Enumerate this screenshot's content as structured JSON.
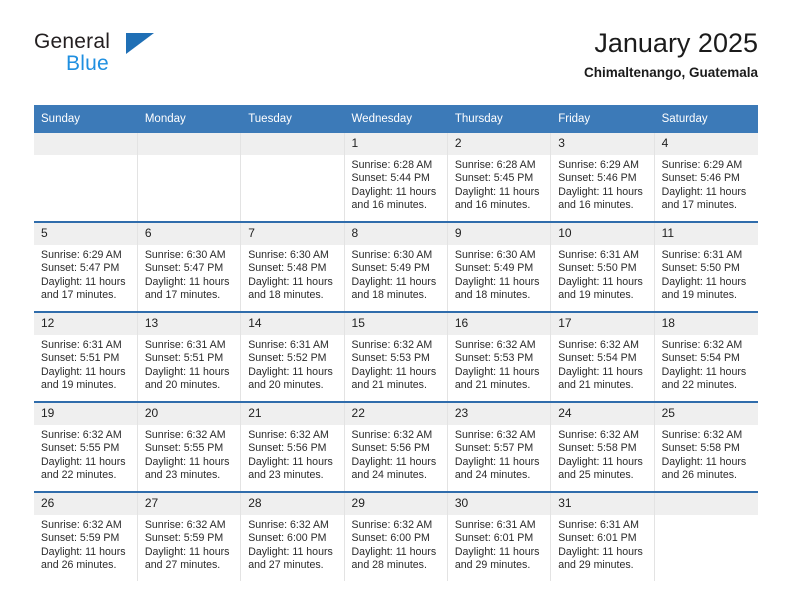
{
  "brand": {
    "name_top": "General",
    "name_bottom": "Blue",
    "triangle_icon": "blue-triangle-logo-icon",
    "color_dark": "#231f20",
    "color_blue": "#1f8fe0",
    "color_triangle": "#1f6fb5"
  },
  "header": {
    "title": "January 2025",
    "subtitle": "Chimaltenango, Guatemala"
  },
  "theme": {
    "header_blue": "#3c7ab8",
    "row_divider_blue": "#2f6cab",
    "daynum_band": "#efefef",
    "text": "#222222"
  },
  "weekday_headers": [
    "Sunday",
    "Monday",
    "Tuesday",
    "Wednesday",
    "Thursday",
    "Friday",
    "Saturday"
  ],
  "labels": {
    "sunrise_prefix": "Sunrise:",
    "sunset_prefix": "Sunset:",
    "daylight_prefix": "Daylight:"
  },
  "weeks": [
    [
      {
        "day": "",
        "sunrise": "",
        "sunset": "",
        "daylight_line1": "",
        "daylight_line2": "",
        "blank": true
      },
      {
        "day": "",
        "sunrise": "",
        "sunset": "",
        "daylight_line1": "",
        "daylight_line2": "",
        "blank": true
      },
      {
        "day": "",
        "sunrise": "",
        "sunset": "",
        "daylight_line1": "",
        "daylight_line2": "",
        "blank": true
      },
      {
        "day": "1",
        "sunrise": "Sunrise: 6:28 AM",
        "sunset": "Sunset: 5:44 PM",
        "daylight_line1": "Daylight: 11 hours",
        "daylight_line2": "and 16 minutes.",
        "blank": false
      },
      {
        "day": "2",
        "sunrise": "Sunrise: 6:28 AM",
        "sunset": "Sunset: 5:45 PM",
        "daylight_line1": "Daylight: 11 hours",
        "daylight_line2": "and 16 minutes.",
        "blank": false
      },
      {
        "day": "3",
        "sunrise": "Sunrise: 6:29 AM",
        "sunset": "Sunset: 5:46 PM",
        "daylight_line1": "Daylight: 11 hours",
        "daylight_line2": "and 16 minutes.",
        "blank": false
      },
      {
        "day": "4",
        "sunrise": "Sunrise: 6:29 AM",
        "sunset": "Sunset: 5:46 PM",
        "daylight_line1": "Daylight: 11 hours",
        "daylight_line2": "and 17 minutes.",
        "blank": false
      }
    ],
    [
      {
        "day": "5",
        "sunrise": "Sunrise: 6:29 AM",
        "sunset": "Sunset: 5:47 PM",
        "daylight_line1": "Daylight: 11 hours",
        "daylight_line2": "and 17 minutes.",
        "blank": false
      },
      {
        "day": "6",
        "sunrise": "Sunrise: 6:30 AM",
        "sunset": "Sunset: 5:47 PM",
        "daylight_line1": "Daylight: 11 hours",
        "daylight_line2": "and 17 minutes.",
        "blank": false
      },
      {
        "day": "7",
        "sunrise": "Sunrise: 6:30 AM",
        "sunset": "Sunset: 5:48 PM",
        "daylight_line1": "Daylight: 11 hours",
        "daylight_line2": "and 18 minutes.",
        "blank": false
      },
      {
        "day": "8",
        "sunrise": "Sunrise: 6:30 AM",
        "sunset": "Sunset: 5:49 PM",
        "daylight_line1": "Daylight: 11 hours",
        "daylight_line2": "and 18 minutes.",
        "blank": false
      },
      {
        "day": "9",
        "sunrise": "Sunrise: 6:30 AM",
        "sunset": "Sunset: 5:49 PM",
        "daylight_line1": "Daylight: 11 hours",
        "daylight_line2": "and 18 minutes.",
        "blank": false
      },
      {
        "day": "10",
        "sunrise": "Sunrise: 6:31 AM",
        "sunset": "Sunset: 5:50 PM",
        "daylight_line1": "Daylight: 11 hours",
        "daylight_line2": "and 19 minutes.",
        "blank": false
      },
      {
        "day": "11",
        "sunrise": "Sunrise: 6:31 AM",
        "sunset": "Sunset: 5:50 PM",
        "daylight_line1": "Daylight: 11 hours",
        "daylight_line2": "and 19 minutes.",
        "blank": false
      }
    ],
    [
      {
        "day": "12",
        "sunrise": "Sunrise: 6:31 AM",
        "sunset": "Sunset: 5:51 PM",
        "daylight_line1": "Daylight: 11 hours",
        "daylight_line2": "and 19 minutes.",
        "blank": false
      },
      {
        "day": "13",
        "sunrise": "Sunrise: 6:31 AM",
        "sunset": "Sunset: 5:51 PM",
        "daylight_line1": "Daylight: 11 hours",
        "daylight_line2": "and 20 minutes.",
        "blank": false
      },
      {
        "day": "14",
        "sunrise": "Sunrise: 6:31 AM",
        "sunset": "Sunset: 5:52 PM",
        "daylight_line1": "Daylight: 11 hours",
        "daylight_line2": "and 20 minutes.",
        "blank": false
      },
      {
        "day": "15",
        "sunrise": "Sunrise: 6:32 AM",
        "sunset": "Sunset: 5:53 PM",
        "daylight_line1": "Daylight: 11 hours",
        "daylight_line2": "and 21 minutes.",
        "blank": false
      },
      {
        "day": "16",
        "sunrise": "Sunrise: 6:32 AM",
        "sunset": "Sunset: 5:53 PM",
        "daylight_line1": "Daylight: 11 hours",
        "daylight_line2": "and 21 minutes.",
        "blank": false
      },
      {
        "day": "17",
        "sunrise": "Sunrise: 6:32 AM",
        "sunset": "Sunset: 5:54 PM",
        "daylight_line1": "Daylight: 11 hours",
        "daylight_line2": "and 21 minutes.",
        "blank": false
      },
      {
        "day": "18",
        "sunrise": "Sunrise: 6:32 AM",
        "sunset": "Sunset: 5:54 PM",
        "daylight_line1": "Daylight: 11 hours",
        "daylight_line2": "and 22 minutes.",
        "blank": false
      }
    ],
    [
      {
        "day": "19",
        "sunrise": "Sunrise: 6:32 AM",
        "sunset": "Sunset: 5:55 PM",
        "daylight_line1": "Daylight: 11 hours",
        "daylight_line2": "and 22 minutes.",
        "blank": false
      },
      {
        "day": "20",
        "sunrise": "Sunrise: 6:32 AM",
        "sunset": "Sunset: 5:55 PM",
        "daylight_line1": "Daylight: 11 hours",
        "daylight_line2": "and 23 minutes.",
        "blank": false
      },
      {
        "day": "21",
        "sunrise": "Sunrise: 6:32 AM",
        "sunset": "Sunset: 5:56 PM",
        "daylight_line1": "Daylight: 11 hours",
        "daylight_line2": "and 23 minutes.",
        "blank": false
      },
      {
        "day": "22",
        "sunrise": "Sunrise: 6:32 AM",
        "sunset": "Sunset: 5:56 PM",
        "daylight_line1": "Daylight: 11 hours",
        "daylight_line2": "and 24 minutes.",
        "blank": false
      },
      {
        "day": "23",
        "sunrise": "Sunrise: 6:32 AM",
        "sunset": "Sunset: 5:57 PM",
        "daylight_line1": "Daylight: 11 hours",
        "daylight_line2": "and 24 minutes.",
        "blank": false
      },
      {
        "day": "24",
        "sunrise": "Sunrise: 6:32 AM",
        "sunset": "Sunset: 5:58 PM",
        "daylight_line1": "Daylight: 11 hours",
        "daylight_line2": "and 25 minutes.",
        "blank": false
      },
      {
        "day": "25",
        "sunrise": "Sunrise: 6:32 AM",
        "sunset": "Sunset: 5:58 PM",
        "daylight_line1": "Daylight: 11 hours",
        "daylight_line2": "and 26 minutes.",
        "blank": false
      }
    ],
    [
      {
        "day": "26",
        "sunrise": "Sunrise: 6:32 AM",
        "sunset": "Sunset: 5:59 PM",
        "daylight_line1": "Daylight: 11 hours",
        "daylight_line2": "and 26 minutes.",
        "blank": false
      },
      {
        "day": "27",
        "sunrise": "Sunrise: 6:32 AM",
        "sunset": "Sunset: 5:59 PM",
        "daylight_line1": "Daylight: 11 hours",
        "daylight_line2": "and 27 minutes.",
        "blank": false
      },
      {
        "day": "28",
        "sunrise": "Sunrise: 6:32 AM",
        "sunset": "Sunset: 6:00 PM",
        "daylight_line1": "Daylight: 11 hours",
        "daylight_line2": "and 27 minutes.",
        "blank": false
      },
      {
        "day": "29",
        "sunrise": "Sunrise: 6:32 AM",
        "sunset": "Sunset: 6:00 PM",
        "daylight_line1": "Daylight: 11 hours",
        "daylight_line2": "and 28 minutes.",
        "blank": false
      },
      {
        "day": "30",
        "sunrise": "Sunrise: 6:31 AM",
        "sunset": "Sunset: 6:01 PM",
        "daylight_line1": "Daylight: 11 hours",
        "daylight_line2": "and 29 minutes.",
        "blank": false
      },
      {
        "day": "31",
        "sunrise": "Sunrise: 6:31 AM",
        "sunset": "Sunset: 6:01 PM",
        "daylight_line1": "Daylight: 11 hours",
        "daylight_line2": "and 29 minutes.",
        "blank": false
      },
      {
        "day": "",
        "sunrise": "",
        "sunset": "",
        "daylight_line1": "",
        "daylight_line2": "",
        "blank": true
      }
    ]
  ]
}
